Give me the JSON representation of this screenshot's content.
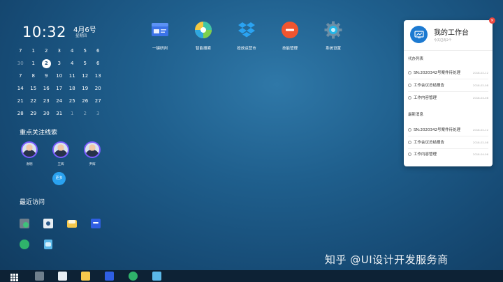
{
  "clock": {
    "time": "10:32",
    "date": "4月6号",
    "weekday": "星期四"
  },
  "calendar": {
    "rows": [
      [
        {
          "d": "7"
        },
        {
          "d": "1"
        },
        {
          "d": "2"
        },
        {
          "d": "3"
        },
        {
          "d": "4"
        },
        {
          "d": "5"
        },
        {
          "d": "6"
        }
      ],
      [
        {
          "d": "30",
          "muted": true
        },
        {
          "d": "1"
        },
        {
          "d": "2",
          "today": true
        },
        {
          "d": "3"
        },
        {
          "d": "4"
        },
        {
          "d": "5"
        },
        {
          "d": "6"
        }
      ],
      [
        {
          "d": "7"
        },
        {
          "d": "8"
        },
        {
          "d": "9"
        },
        {
          "d": "10"
        },
        {
          "d": "11"
        },
        {
          "d": "12"
        },
        {
          "d": "13"
        }
      ],
      [
        {
          "d": "14"
        },
        {
          "d": "15"
        },
        {
          "d": "16"
        },
        {
          "d": "17"
        },
        {
          "d": "18"
        },
        {
          "d": "19"
        },
        {
          "d": "20"
        }
      ],
      [
        {
          "d": "21"
        },
        {
          "d": "22"
        },
        {
          "d": "23"
        },
        {
          "d": "24"
        },
        {
          "d": "25"
        },
        {
          "d": "26"
        },
        {
          "d": "27"
        }
      ],
      [
        {
          "d": "28"
        },
        {
          "d": "29"
        },
        {
          "d": "30"
        },
        {
          "d": "31"
        },
        {
          "d": "1",
          "muted": true
        },
        {
          "d": "2",
          "muted": true
        },
        {
          "d": "3",
          "muted": true
        }
      ]
    ]
  },
  "focus": {
    "title": "重点关注线索",
    "people": [
      "谢明",
      "王辉",
      "尹辉"
    ],
    "more_label": "更多"
  },
  "recent": {
    "title": "最近访问"
  },
  "apps": [
    {
      "label": "一键研判",
      "icon": "card-icon"
    },
    {
      "label": "智能搜索",
      "icon": "color-wheel-icon"
    },
    {
      "label": "投放运营市",
      "icon": "dropbox-icon"
    },
    {
      "label": "技能管理",
      "icon": "minus-circle-icon"
    },
    {
      "label": "系统设置",
      "icon": "gear-icon"
    }
  ],
  "panel": {
    "title": "我的工作台",
    "subtitle": "今天已有2个",
    "todo_title": "代办列表",
    "todo": [
      {
        "text": "SN:2020342号案件待处理",
        "date": "2018-02-12"
      },
      {
        "text": "工作会议总结报告",
        "date": "2018-02-08"
      },
      {
        "text": "工作内容管理",
        "date": "2018-04-08"
      }
    ],
    "news_title": "最新消息",
    "news": [
      {
        "text": "SN:2020342号案件待处理",
        "date": "2018-02-12"
      },
      {
        "text": "工作会议总结报告",
        "date": "2018-02-08"
      },
      {
        "text": "工作内容管理",
        "date": "2018-04-06"
      }
    ]
  },
  "watermark": "知乎 @UI设计开发服务商",
  "colors": {
    "accent": "#2aa2f0",
    "panel_logo": "#1d7ad1",
    "close": "#f0473e",
    "taskbar": "#0d2235"
  }
}
